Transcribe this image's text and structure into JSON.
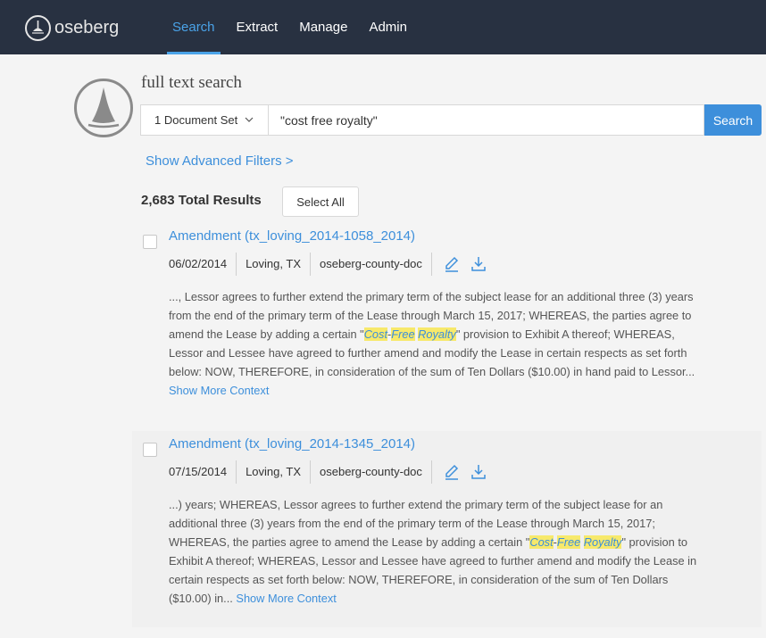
{
  "brand": {
    "name": "oseberg"
  },
  "nav": {
    "items": [
      "Search",
      "Extract",
      "Manage",
      "Admin"
    ],
    "active": "Search"
  },
  "search": {
    "title": "full text search",
    "doc_set_label": "1 Document Set",
    "query": "\"cost free royalty\"",
    "button_label": "Search"
  },
  "filters": {
    "advanced_label": "Show Advanced Filters >"
  },
  "results_header": {
    "total_label": "2,683 Total Results",
    "select_all_label": "Select All"
  },
  "results": [
    {
      "title": "Amendment (tx_loving_2014-1058_2014)",
      "date": "06/02/2014",
      "location": "Loving, TX",
      "source": "oseberg-county-doc",
      "snippet_before": "..., Lessor agrees to further extend the primary term of the subject lease for an additional three (3) years from the end of the primary term of the Lease through March 15, 2017; WHEREAS, the parties agree to amend the Lease by adding a certain \"",
      "hl1": "Cost",
      "sep1": "-",
      "hl2": "Free",
      "sep2": " ",
      "hl3": "Royalty",
      "snippet_after": "\" provision to Exhibit A thereof; WHEREAS, Lessor and Lessee have agreed to further amend and modify the Lease in certain respects as set forth below: NOW, THEREFORE, in consideration of the sum of Ten Dollars ($10.00) in hand paid to Lessor... ",
      "more_label": "Show More Context"
    },
    {
      "title": "Amendment (tx_loving_2014-1345_2014)",
      "date": "07/15/2014",
      "location": "Loving, TX",
      "source": "oseberg-county-doc",
      "snippet_before": "...) years; WHEREAS, Lessor agrees to further extend the primary term of the subject lease for an additional three (3) years from the end of the primary term of the Lease through March 15, 2017; WHEREAS, the parties agree to amend the Lease by adding a certain \"",
      "hl1": "Cost",
      "sep1": "-",
      "hl2": "Free",
      "sep2": " ",
      "hl3": "Royalty",
      "snippet_after": "\" provision to Exhibit A thereof; WHEREAS, Lessor and Lessee have agreed to further amend and modify the Lease in certain respects as set forth below: NOW, THEREFORE, in consideration of the sum of Ten Dollars ($10.00) in... ",
      "more_label": "Show More Context"
    }
  ],
  "colors": {
    "nav_bg": "#283141",
    "accent": "#3d8fdb",
    "highlight": "#f7e96b"
  },
  "icons": [
    "oseberg-logo-icon",
    "chevron-down-icon",
    "edit-pencil-icon",
    "download-icon"
  ]
}
